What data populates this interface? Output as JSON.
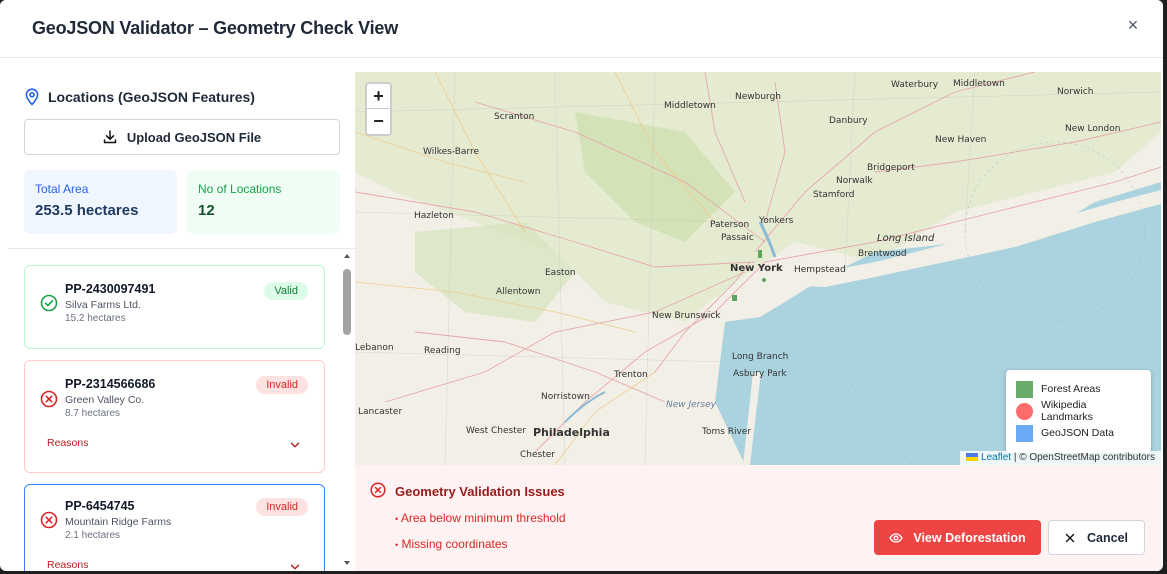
{
  "modal": {
    "title": "GeoJSON Validator – Geometry Check View",
    "close_label": "×"
  },
  "sidebar": {
    "heading": "Locations (GeoJSON Features)",
    "upload_label": "Upload GeoJSON File",
    "stats": {
      "total_area_label": "Total Area",
      "total_area_value": "253.5 hectares",
      "locations_label": "No of Locations",
      "locations_value": "12"
    },
    "cards": [
      {
        "id": "PP-2430097491",
        "owner": "Silva Farms Ltd.",
        "area": "15.2 hectares",
        "status": "Valid"
      },
      {
        "id": "PP-2314566686",
        "owner": "Green Valley Co.",
        "area": "8.7 hectares",
        "status": "Invalid",
        "reasons_label": "Reasons"
      },
      {
        "id": "PP-6454745",
        "owner": "Mountain Ridge Farms",
        "area": "2.1 hectares",
        "status": "Invalid",
        "reasons_label": "Reasons"
      }
    ]
  },
  "map": {
    "zoom_in": "+",
    "zoom_out": "−",
    "labels": [
      "Middletown",
      "Newburgh",
      "Waterbury",
      "Middletown",
      "Norwich",
      "Scranton",
      "Danbury",
      "New London",
      "Wilkes-Barre",
      "New Haven",
      "Bridgeport",
      "Norwalk",
      "Stamford",
      "Hazleton",
      "Paterson",
      "Yonkers",
      "Passaic",
      "Long Island",
      "Brentwood",
      "New York",
      "Hempstead",
      "Easton",
      "Allentown",
      "New Brunswick",
      "Reading",
      "Long Branch",
      "Asbury Park",
      "Trenton",
      "Norristown",
      "New Jersey",
      "Lancaster",
      "West Chester",
      "Philadelphia",
      "Toms River",
      "Chester",
      "Lebanon"
    ],
    "legend": [
      {
        "label": "Forest Areas",
        "color": "#6aab6a",
        "shape": "square"
      },
      {
        "label": "Wikipedia Landmarks",
        "color": "#ff6b6b",
        "shape": "circle"
      },
      {
        "label": "GeoJSON Data",
        "color": "#6aaaf5",
        "shape": "square"
      }
    ],
    "attribution_leaflet": "Leaflet",
    "attribution_osm": "| © OpenStreetMap contributors"
  },
  "issues": {
    "title": "Geometry Validation Issues",
    "items": [
      "Area below minimum threshold",
      "Missing coordinates"
    ]
  },
  "actions": {
    "deforestation_label": "View Deforestation",
    "cancel_label": "Cancel"
  },
  "colors": {
    "valid": "#16a34a",
    "invalid": "#dc2626",
    "primary_danger": "#ef4444",
    "selected_border": "#3b82f6"
  }
}
